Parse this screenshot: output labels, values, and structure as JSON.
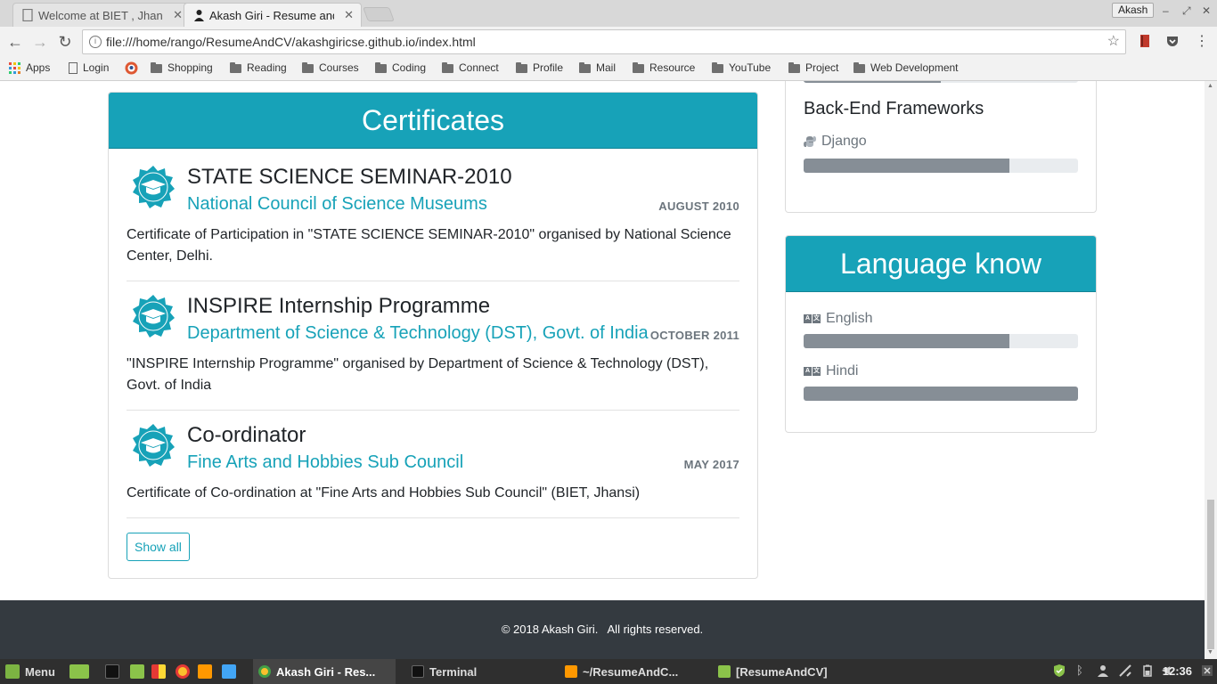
{
  "browser": {
    "tabs": [
      {
        "title": "Welcome at BIET , Jhansi",
        "active": false
      },
      {
        "title": "Akash Giri - Resume and CV",
        "active": true
      }
    ],
    "profile": "Akash",
    "url": "file:///home/rango/ResumeAndCV/akashgiricse.github.io/index.html",
    "bookmarks": [
      {
        "label": "Apps",
        "icon": "apps-grid-icon"
      },
      {
        "label": "Login",
        "icon": "page-icon"
      },
      {
        "label": "",
        "icon": "duckduckgo-icon"
      },
      {
        "label": "Shopping",
        "icon": "folder-icon"
      },
      {
        "label": "Reading",
        "icon": "folder-icon"
      },
      {
        "label": "Courses",
        "icon": "folder-icon"
      },
      {
        "label": "Coding",
        "icon": "folder-icon"
      },
      {
        "label": "Connect",
        "icon": "folder-icon"
      },
      {
        "label": "Profile",
        "icon": "folder-icon"
      },
      {
        "label": "Mail",
        "icon": "folder-icon"
      },
      {
        "label": "Resource",
        "icon": "folder-icon"
      },
      {
        "label": "YouTube",
        "icon": "folder-icon"
      },
      {
        "label": "Project",
        "icon": "folder-icon"
      },
      {
        "label": "Web Development",
        "icon": "folder-icon"
      }
    ]
  },
  "certificates": {
    "title": "Certificates",
    "items": [
      {
        "title": "STATE SCIENCE SEMINAR-2010",
        "org": "National Council of Science Museums",
        "date": "AUGUST 2010",
        "desc": "Certificate of Participation in \"STATE SCIENCE SEMINAR-2010\" organised by National Science Center, Delhi."
      },
      {
        "title": "INSPIRE Internship Programme",
        "org": "Department of Science & Technology (DST), Govt. of India",
        "date": "OCTOBER 2011",
        "desc": "\"INSPIRE Internship Programme\" organised by Department of Science & Technology (DST), Govt. of India"
      },
      {
        "title": "Co-ordinator",
        "org": "Fine Arts and Hobbies Sub Council",
        "date": "MAY 2017",
        "desc": "Certificate of Co-ordination at \"Fine Arts and Hobbies Sub Council\" (BIET, Jhansi)"
      }
    ],
    "show_all": "Show all"
  },
  "skills": {
    "previous_bar_level": 0.5,
    "section_title": "Back-End Frameworks",
    "items": [
      {
        "label": "Django",
        "icon": "python-icon",
        "level": 0.75
      }
    ]
  },
  "languages": {
    "title": "Language know",
    "items": [
      {
        "label": "English",
        "icon": "language-icon",
        "level": 0.75
      },
      {
        "label": "Hindi",
        "icon": "language-icon",
        "level": 1.0
      }
    ]
  },
  "footer": {
    "text": "© 2018 Akash Giri.   All rights reserved."
  },
  "taskbar": {
    "menu": "Menu",
    "windows": [
      {
        "label": "Akash Giri - Res...",
        "active": true
      },
      {
        "label": "Terminal",
        "active": false
      },
      {
        "label": "~/ResumeAndC...",
        "active": false
      },
      {
        "label": "[ResumeAndCV]",
        "active": false
      }
    ],
    "clock": "12:36"
  },
  "colors": {
    "accent": "#17a2b8",
    "footer": "#343a40",
    "bar": "#868e96"
  }
}
